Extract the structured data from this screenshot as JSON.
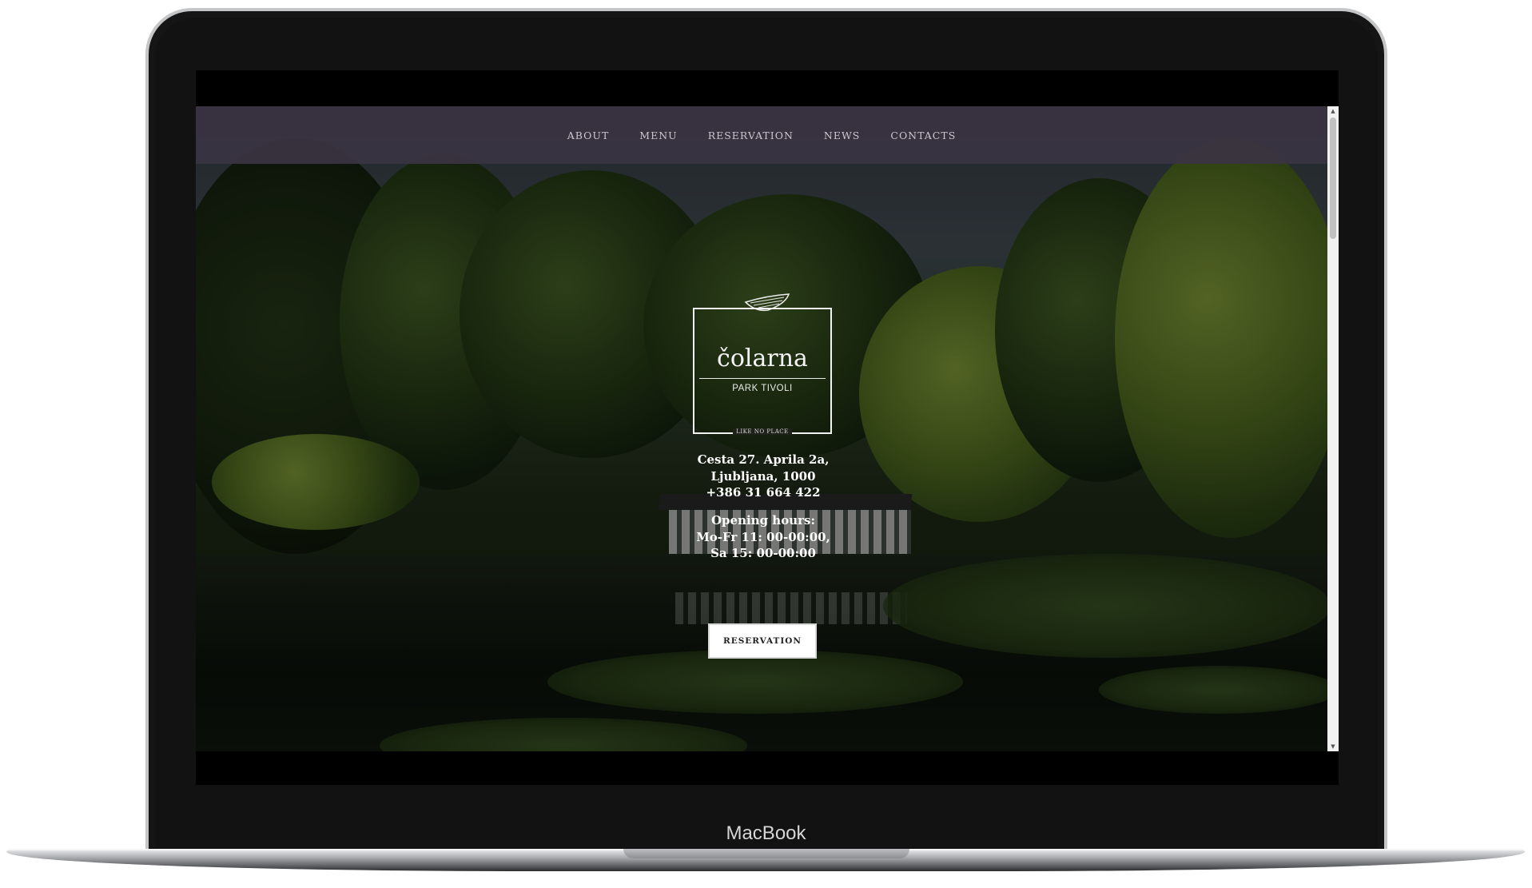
{
  "device": {
    "label": "MacBook"
  },
  "nav": {
    "items": [
      {
        "label": "ABOUT"
      },
      {
        "label": "MENU"
      },
      {
        "label": "RESERVATION"
      },
      {
        "label": "NEWS"
      },
      {
        "label": "CONTACTS"
      }
    ]
  },
  "logo": {
    "name": "čolarna",
    "subtitle": "PARK TIVOLI",
    "tagline": "LIKE NO PLACE",
    "icon": "boat-icon"
  },
  "contact": {
    "street": "Cesta 27. Aprila 2a,",
    "city": "Ljubljana, 1000",
    "phone": "+386 31 664 422"
  },
  "hours": {
    "title": "Opening hours:",
    "weekdays": "Mo-Fr 11: 00-00:00,",
    "saturday": "Sa 15: 00-00:00"
  },
  "cta": {
    "label": "RESERVATION"
  },
  "colors": {
    "navbar": "#3a3442",
    "button_bg": "#ffffff",
    "text": "#ffffff"
  }
}
